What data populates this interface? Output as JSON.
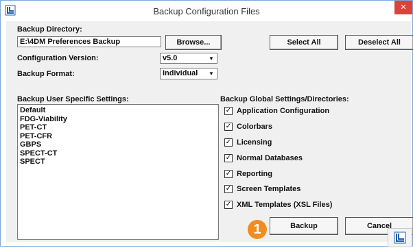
{
  "window": {
    "title": "Backup Configuration Files",
    "close_glyph": "✕",
    "app_icon": "app-logo-icon",
    "close_color": "#d9443a"
  },
  "backup_directory": {
    "label": "Backup Directory:",
    "value": "E:\\4DM Preferences Backup",
    "browse_label": "Browse..."
  },
  "configuration_version": {
    "label": "Configuration Version:",
    "value": "v5.0"
  },
  "backup_format": {
    "label": "Backup Format:",
    "value": "Individual"
  },
  "buttons": {
    "select_all": "Select All",
    "deselect_all": "Deselect All",
    "backup": "Backup",
    "cancel": "Cancel"
  },
  "user_settings": {
    "label": "Backup User Specific Settings:",
    "items": [
      "Default",
      "FDG-Viability",
      "PET-CT",
      "PET-CFR",
      "GBPS",
      "SPECT-CT",
      "SPECT"
    ]
  },
  "global_settings": {
    "label": "Backup Global Settings/Directories:",
    "items": [
      {
        "label": "Application Configuration",
        "checked": true,
        "glyph": "✓"
      },
      {
        "label": "Colorbars",
        "checked": true,
        "glyph": "✓"
      },
      {
        "label": "Licensing",
        "checked": true,
        "glyph": "✓"
      },
      {
        "label": "Normal Databases",
        "checked": true,
        "glyph": "✓"
      },
      {
        "label": "Reporting",
        "checked": true,
        "glyph": "✓"
      },
      {
        "label": "Screen Templates",
        "checked": true,
        "glyph": "✓"
      },
      {
        "label": "XML Templates (XSL Files)",
        "checked": true,
        "glyph": "✓"
      }
    ]
  },
  "callout": {
    "number": "1",
    "color": "#f28c1e"
  }
}
